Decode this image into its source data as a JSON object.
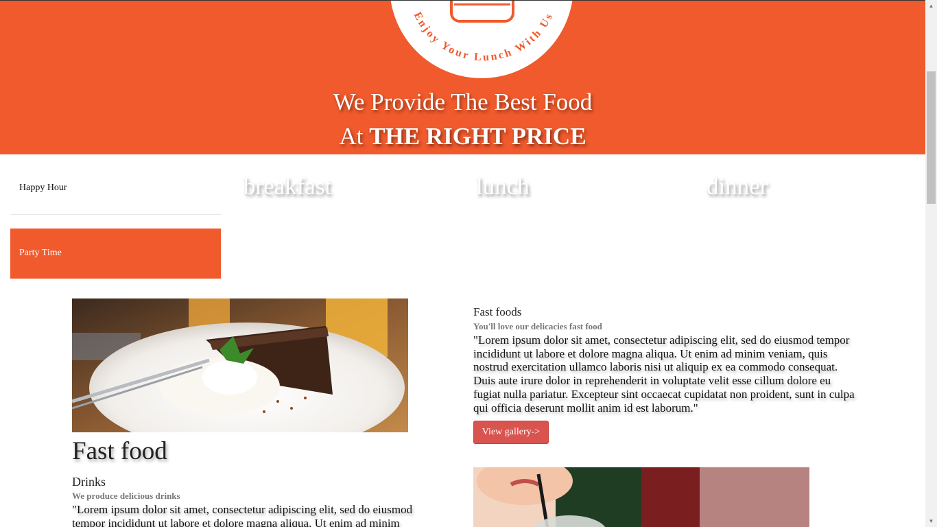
{
  "hero": {
    "logo_text": "Enjoy Your Lunch With Us",
    "line1": "We Provide The Best Food",
    "line2_prefix": "At",
    "line2_bold": "THE RIGHT PRICE"
  },
  "side_menu": {
    "items": [
      {
        "label": "Happy Hour"
      },
      {
        "label": "Party Time"
      }
    ]
  },
  "meal_tabs": [
    "breakfast",
    "lunch",
    "dinner"
  ],
  "left_section": {
    "title": "Fast food",
    "subheading": "Drinks",
    "tagline": "We produce delicious drinks",
    "body": "\"Lorem ipsum dolor sit amet, consectetur adipiscing elit, sed do eiusmod tempor incididunt ut labore et dolore magna aliqua. Ut enim ad minim"
  },
  "right_section": {
    "heading": "Fast foods",
    "tagline": "You'll love our delicacies fast food",
    "body": "\"Lorem ipsum dolor sit amet, consectetur adipiscing elit, sed do eiusmod tempor incididunt ut labore et dolore magna aliqua. Ut enim ad minim veniam, quis nostrud exercitation ullamco laboris nisi ut aliquip ex ea commodo consequat. Duis aute irure dolor in reprehenderit in voluptate velit esse cillum dolore eu fugiat nulla pariatur. Excepteur sint occaecat cupidatat non proident, sunt in culpa qui officia deserunt mollit anim id est laborum.\"",
    "button_label": "View gallery->"
  },
  "colors": {
    "accent": "#f05a2c",
    "button": "#d9534f"
  }
}
